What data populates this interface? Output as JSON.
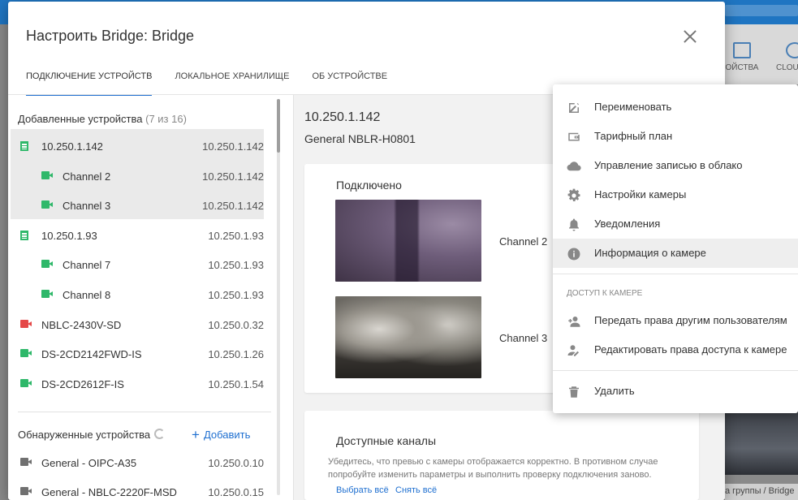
{
  "background": {
    "toolbar_items": [
      "ОЙСТВА",
      "CLOU"
    ],
    "breadcrumb": "а группы / Bridge"
  },
  "dialog": {
    "title": "Настроить Bridge: Bridge",
    "tabs": [
      {
        "label": "Подключение устройств",
        "active": true
      },
      {
        "label": "Локальное хранилище",
        "active": false
      },
      {
        "label": "Об устройстве",
        "active": false
      }
    ]
  },
  "added": {
    "title": "Добавленные устройства",
    "count": "(7 из 16)",
    "items": [
      {
        "name": "10.250.1.142",
        "ip": "10.250.1.142",
        "kind": "server",
        "level": 0
      },
      {
        "name": "Channel 2",
        "ip": "10.250.1.142",
        "kind": "camera",
        "status": "green",
        "level": 1
      },
      {
        "name": "Channel 3",
        "ip": "10.250.1.142",
        "kind": "camera",
        "status": "green",
        "level": 1
      },
      {
        "name": "10.250.1.93",
        "ip": "10.250.1.93",
        "kind": "server",
        "level": 0
      },
      {
        "name": "Channel 7",
        "ip": "10.250.1.93",
        "kind": "camera",
        "status": "green",
        "level": 1
      },
      {
        "name": "Channel 8",
        "ip": "10.250.1.93",
        "kind": "camera",
        "status": "green",
        "level": 1
      },
      {
        "name": "NBLC-2430V-SD",
        "ip": "10.250.0.32",
        "kind": "camera",
        "status": "red",
        "level": 0
      },
      {
        "name": "DS-2CD2142FWD-IS",
        "ip": "10.250.1.26",
        "kind": "camera",
        "status": "green",
        "level": 0
      },
      {
        "name": "DS-2CD2612F-IS",
        "ip": "10.250.1.54",
        "kind": "camera",
        "status": "green",
        "level": 0
      }
    ]
  },
  "discovered": {
    "title": "Обнаруженные устройства",
    "add_label": "Добавить",
    "items": [
      {
        "name": "General - OIPC-A35",
        "ip": "10.250.0.10",
        "kind": "camera",
        "status": "gray",
        "level": 0
      },
      {
        "name": "General - NBLC-2220F-MSD",
        "ip": "10.250.0.15",
        "kind": "camera",
        "status": "gray",
        "level": 0
      }
    ]
  },
  "detail": {
    "title": "10.250.1.142",
    "model": "General NBLR-H0801",
    "connected": {
      "title": "Подключено",
      "channels": [
        {
          "label": "Channel 2"
        },
        {
          "label": "Channel 3"
        }
      ]
    },
    "available": {
      "title": "Доступные каналы",
      "hint": "Убедитесь, что превью с камеры отображается корректно. В противном случае попробуйте изменить параметры и выполнить проверку подключения заново.",
      "select_all": "Выбрать всё",
      "deselect_all": "Снять всё"
    }
  },
  "context_menu": {
    "items": [
      {
        "label": "Переименовать",
        "icon": "pencil-icon"
      },
      {
        "label": "Тарифный план",
        "icon": "wallet-icon"
      },
      {
        "label": "Управление записью в облако",
        "icon": "cloud-icon"
      },
      {
        "label": "Настройки камеры",
        "icon": "gear-icon"
      },
      {
        "label": "Уведомления",
        "icon": "bell-icon"
      },
      {
        "label": "Информация о камере",
        "icon": "info-icon",
        "highlighted": true
      }
    ],
    "access_section": "Доступ к камере",
    "access_items": [
      {
        "label": "Передать права другим пользователям",
        "icon": "add-user-icon"
      },
      {
        "label": "Редактировать права доступа к камере",
        "icon": "edit-user-icon"
      }
    ],
    "delete": {
      "label": "Удалить",
      "icon": "trash-icon"
    }
  },
  "colors": {
    "accent": "#1e6fd0",
    "online": "#2fb86a",
    "offline": "#e54848",
    "discovered": "#707070"
  }
}
